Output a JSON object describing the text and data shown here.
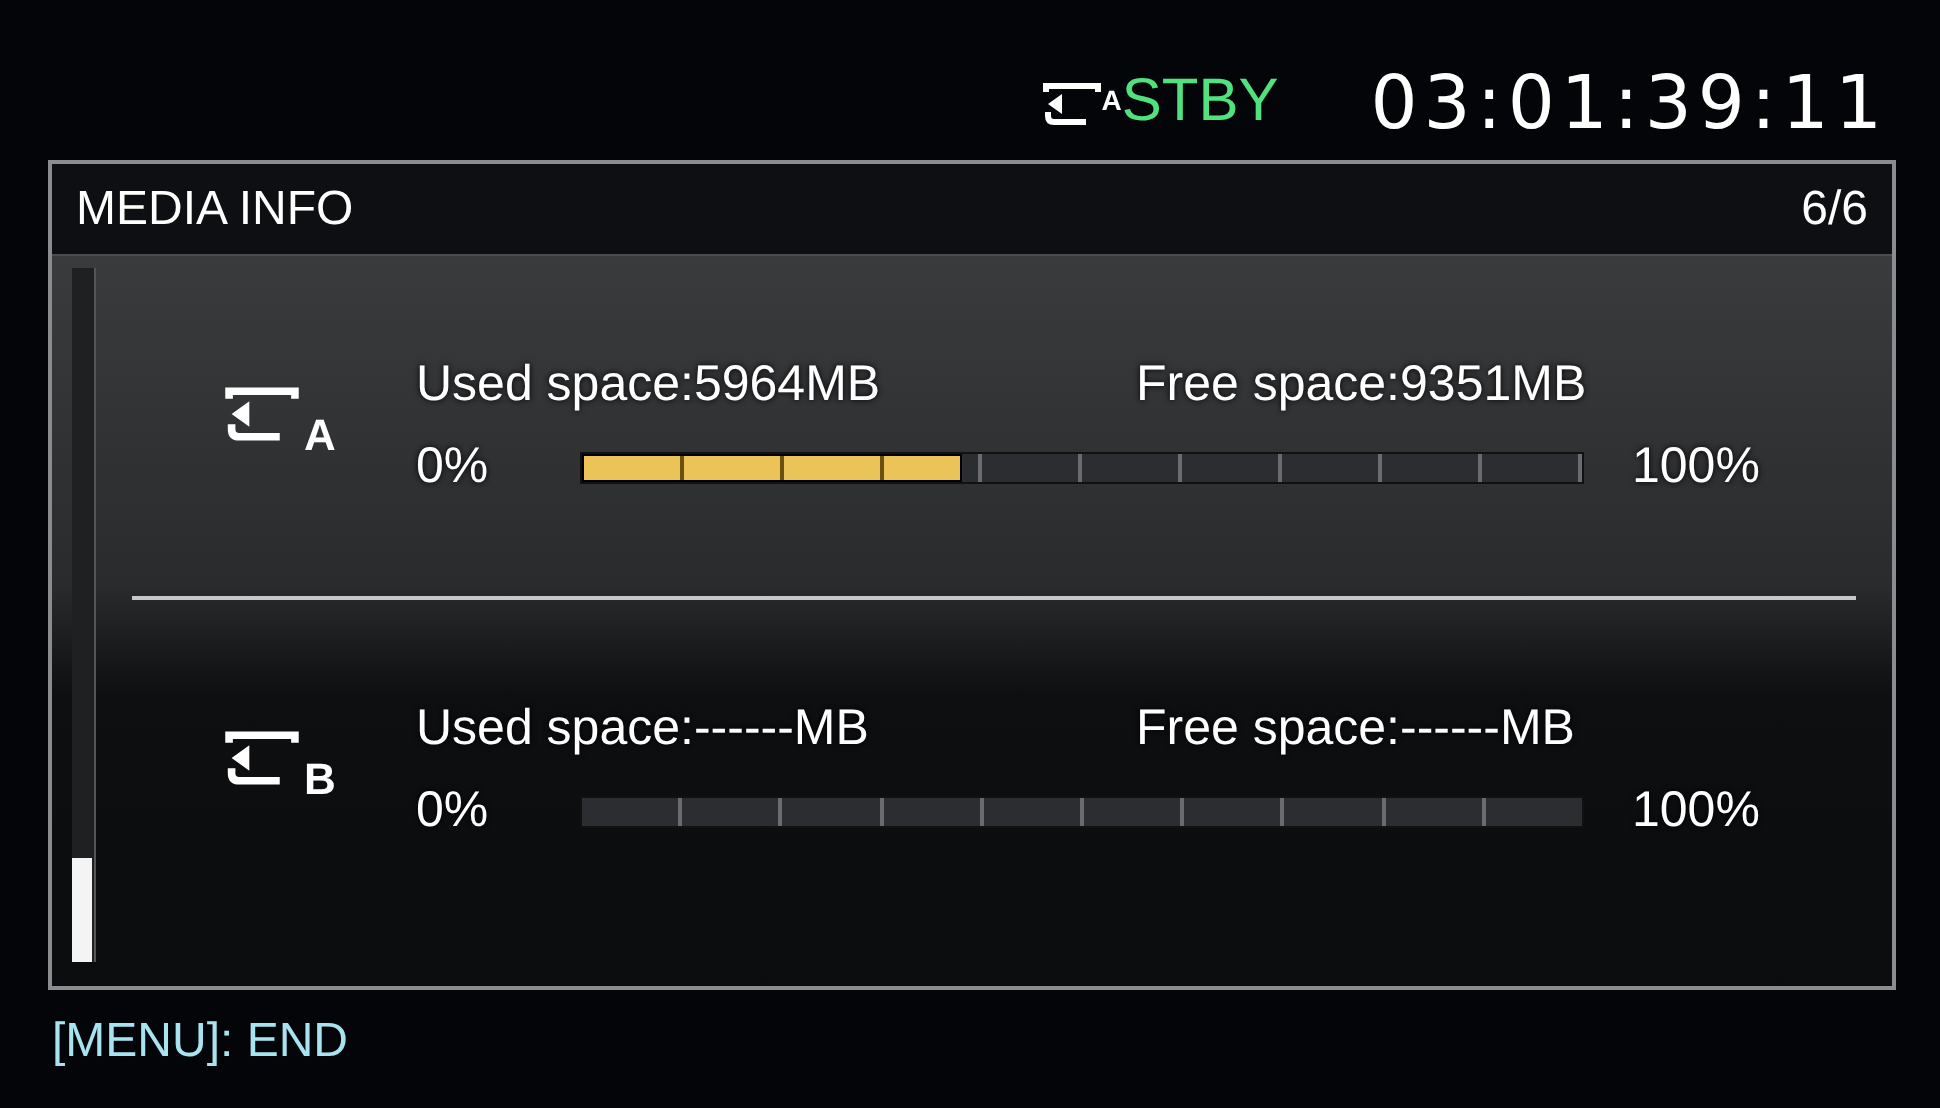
{
  "status": {
    "slot": "A",
    "mode": "STBY",
    "timecode": "03:01:39:11"
  },
  "panel": {
    "title": "MEDIA INFO",
    "page": "6/6"
  },
  "media": [
    {
      "slot": "A",
      "used": "Used space:5964MB",
      "free": "Free space:9351MB",
      "min": "0%",
      "max": "100%",
      "level": 0.38
    },
    {
      "slot": "B",
      "used": "Used space:------MB",
      "free": "Free space:------MB",
      "min": "0%",
      "max": "100%"
    }
  ],
  "footer": "[MENU]: END"
}
